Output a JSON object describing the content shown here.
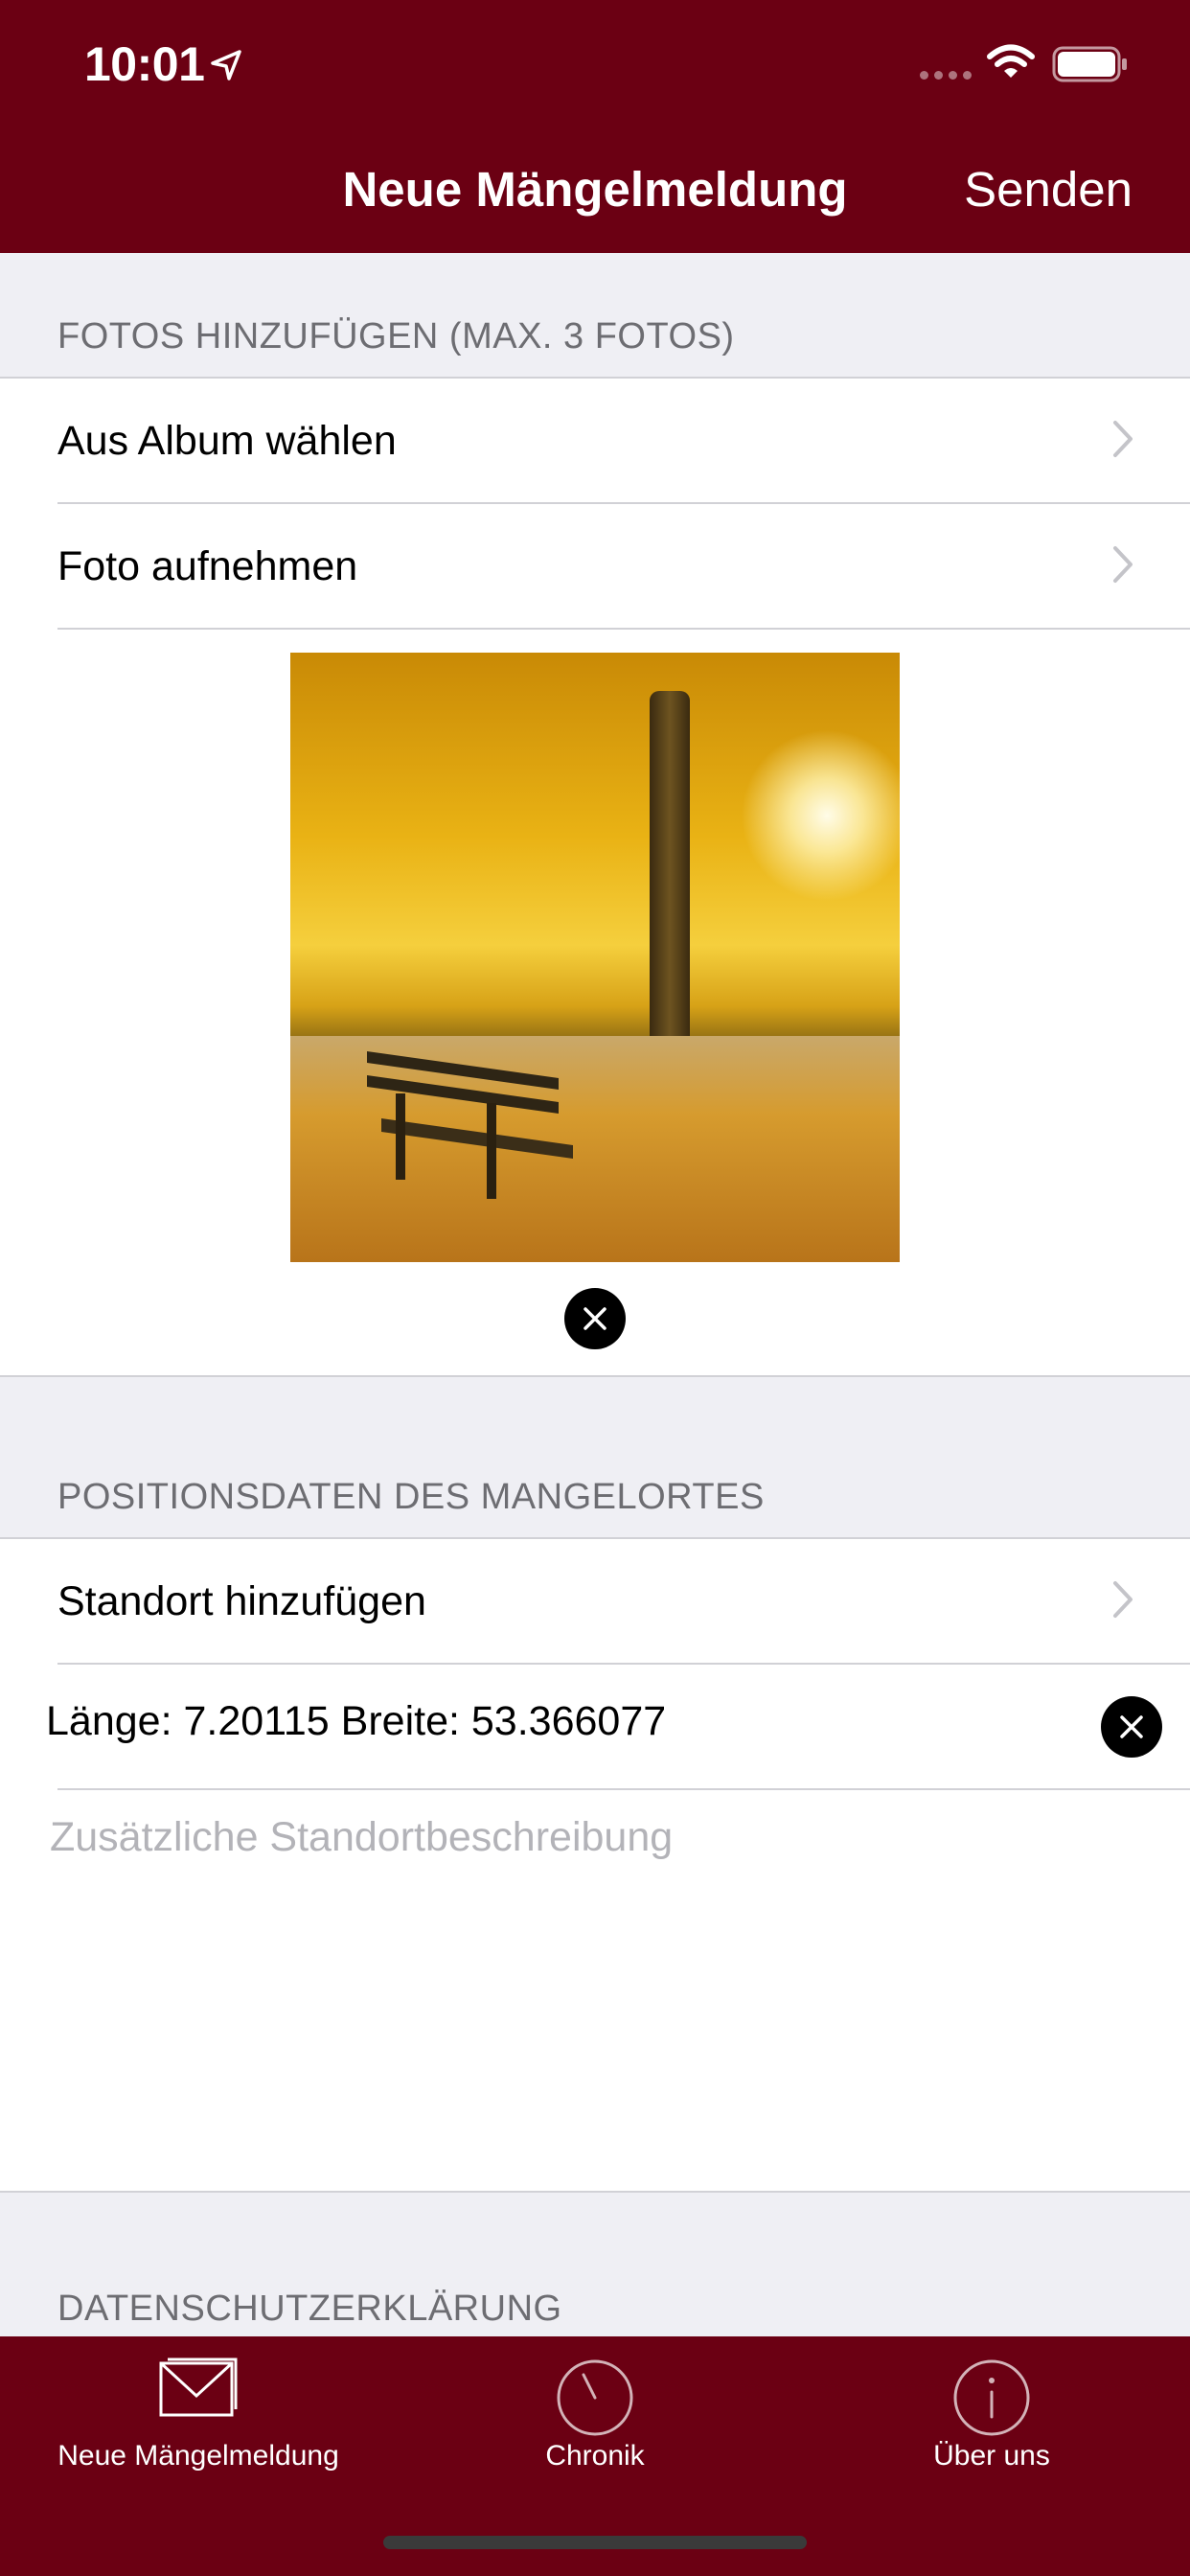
{
  "status_bar": {
    "time": "10:01"
  },
  "nav": {
    "title": "Neue Mängelmeldung",
    "send_label": "Senden"
  },
  "photos_section": {
    "header": "FOTOS HINZUFÜGEN (MAX. 3 FOTOS)",
    "rows": [
      {
        "label": "Aus Album wählen"
      },
      {
        "label": "Foto aufnehmen"
      }
    ]
  },
  "position_section": {
    "header": "POSITIONSDATEN DES MANGELORTES",
    "add_location_label": "Standort hinzufügen",
    "coordinates_text": "Länge: 7.20115 Breite: 53.366077",
    "description_placeholder": "Zusätzliche Standortbeschreibung"
  },
  "privacy_section": {
    "header": "DATENSCHUTZERKLÄRUNG"
  },
  "tabbar": {
    "tabs": [
      {
        "label": "Neue Mängelmeldung",
        "icon": "envelope-icon"
      },
      {
        "label": "Chronik",
        "icon": "clock-icon"
      },
      {
        "label": "Über uns",
        "icon": "info-icon"
      }
    ]
  },
  "colors": {
    "brand": "#6b0013",
    "section_bg": "#efeff4",
    "section_text": "#6d6d72",
    "placeholder": "#b3b3b8"
  }
}
